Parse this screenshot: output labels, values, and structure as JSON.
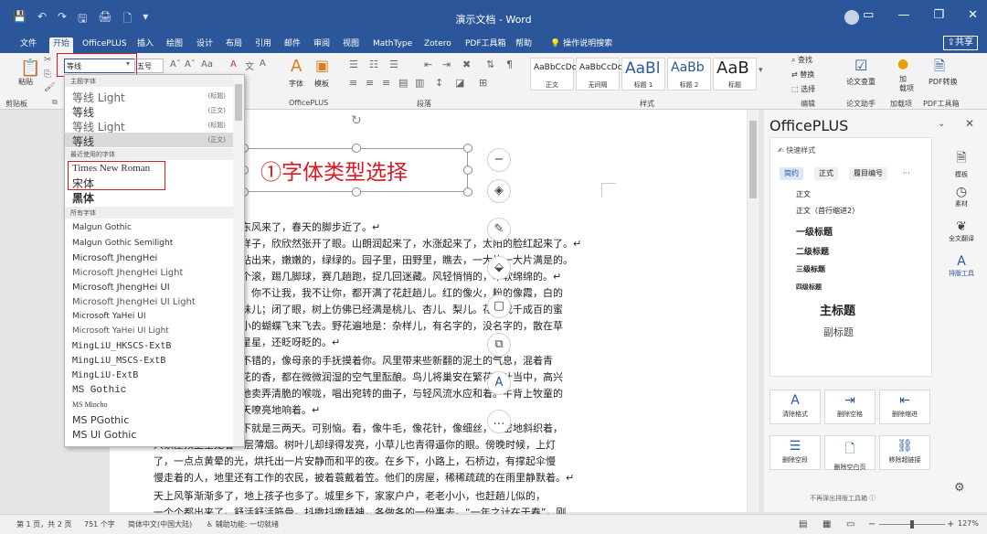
{
  "window": {
    "title": "演示文档 - Word",
    "controls": [
      "▭",
      "—",
      "❐",
      "✕"
    ]
  },
  "quick_access": [
    "💾",
    "↶",
    "↷",
    "🖫",
    "🖨",
    "🗋",
    "▾"
  ],
  "tabs": [
    "文件",
    "开始",
    "OfficePLUS",
    "插入",
    "绘图",
    "设计",
    "布局",
    "引用",
    "邮件",
    "审阅",
    "视图",
    "MathType",
    "Zotero",
    "PDF工具箱",
    "帮助"
  ],
  "tell_me": "操作说明搜索",
  "share": "共享",
  "ribbon": {
    "font_name": "等线",
    "font_size": "五号",
    "paste": "粘贴",
    "clipboard": "剪贴板",
    "font_group_btn": "字体",
    "template_btn": "模板",
    "officeplus_group": "OfficePLUS",
    "paragraph_group": "段落",
    "styles_group": "样式",
    "editing_group": "编辑",
    "find": "查找",
    "replace": "替换",
    "select": "选择",
    "thesis_check": "论文查重",
    "thesis_helper": "论文助手",
    "add_in": "加\n载项",
    "add_in_group": "加载项",
    "pdf_convert": "PDF转换",
    "pdf_group": "PDF工具箱",
    "styles": [
      {
        "preview": "AaBbCcDc",
        "name": "正文"
      },
      {
        "preview": "AaBbCcDc",
        "name": "无间隔"
      },
      {
        "preview": "AaBl",
        "name": "标题 1"
      },
      {
        "preview": "AaBb",
        "name": "标题 2"
      },
      {
        "preview": "AaB",
        "name": "标题"
      }
    ]
  },
  "font_dropdown": {
    "theme_header": "主题字体",
    "theme_fonts": [
      {
        "name": "等线 Light",
        "tag": "(标题)"
      },
      {
        "name": "等线",
        "tag": "(正文)"
      },
      {
        "name": "等线 Light",
        "tag": "(标题)"
      },
      {
        "name": "等线",
        "tag": "(正文)"
      }
    ],
    "recent_header": "最近使用的字体",
    "recent_fonts": [
      "Times New Roman",
      "宋体",
      "黑体"
    ],
    "all_header": "所有字体",
    "all_fonts": [
      "Malgun Gothic",
      "Malgun Gothic Semilight",
      "Microsoft JhengHei",
      "Microsoft JhengHei Light",
      "Microsoft JhengHei UI",
      "Microsoft JhengHei UI Light",
      "Microsoft YaHei UI",
      "Microsoft YaHei UI Light",
      "MingLiU_HKSCS-ExtB",
      "MingLiU_MSCS-ExtB",
      "MingLiU-ExtB",
      "MS Gothic",
      "MS Mincho",
      "MS PGothic",
      "MS UI Gothic"
    ]
  },
  "annotation": "①字体类型选择",
  "document_lines": [
    "东风来了，春天的脚步近了。↵",
    "样子，欣欣然张开了眼。山朗润起来了，水涨起来了，太阳的脸红起来了。↵",
    "钻出来，嫩嫩的，绿绿的。园子里，田野里，瞧去，一大片一大片满是的。",
    "个滚，踢几脚球，赛几趟跑，捉几回迷藏。风轻悄悄的，草软绵绵的。↵",
    "，你不让我，我不让你，都开满了花赶趟儿。红的像火，粉的像霞，白的",
    "味儿；闭了眼，树上仿佛已经满是桃儿、杏儿、梨儿。花下成千成百的蜜",
    "小的蝴蝶飞来飞去。野花遍地是：杂样儿，有名字的，没名字的，散在草",
    "星星，还眨呀眨的。↵",
    "   不错的，像母亲的手抚摸着你。风里带来些新翻的泥土的气息，混着青",
    "花的香，都在微微润湿的空气里酝酿。鸟儿将巢安在繁花嫩叶当中，高兴",
    "地卖弄清脆的喉咙，唱出宛转的曲子，与轻风流水应和着。牛背上牧童的",
    "天嘹亮地响着。↵",
    "下就是三两天。可别恼。看，像牛毛，像花针，像细丝，密密地斜织着，",
    "人家屋顶上全笼着一层薄烟。树叶儿却绿得发亮，小草儿也青得逼你的眼。傍晚时候，上灯",
    "了，一点点黄晕的光，烘托出一片安静而和平的夜。在乡下，小路上，石桥边，有撑起伞慢",
    "慢走着的人，地里还有工作的农民，披着蓑戴着笠。他们的房屋，稀稀疏疏的在雨里静默着。↵",
    "天上风筝渐渐多了，地上孩子也多了。城里乡下，家家户户，老老小小，也赶趟儿似的，",
    "一个个都出来了。舒活舒活筋骨，抖擞抖擞精神，各做各的一份事去。“一年之计在于春”，刚"
  ],
  "pane": {
    "title": "OfficePLUS",
    "quick_styles": "快速样式",
    "pills": [
      "简约",
      "正式",
      "履目编号",
      "···"
    ],
    "style_items": [
      "正文",
      "正文（首行缩进2）",
      "一级标题",
      "二级标题",
      "三级标题",
      "四级标题",
      "主标题",
      "副标题"
    ],
    "tools": [
      {
        "icon": "A",
        "label": "清除格式"
      },
      {
        "icon": "⇥",
        "label": "删除空格"
      },
      {
        "icon": "⇤",
        "label": "删除缩进"
      },
      {
        "icon": "☰",
        "label": "删除空段"
      },
      {
        "icon": "🗋",
        "label": "删除空白页"
      },
      {
        "icon": "⛓",
        "label": "移除超链接"
      }
    ],
    "dont_show": "不再弹出排版工具箱 ⓘ",
    "side_tools": [
      {
        "icon": "🗎",
        "label": "模板"
      },
      {
        "icon": "◷",
        "label": "素材"
      },
      {
        "icon": "❦",
        "label": "全文翻译"
      },
      {
        "icon": "A",
        "label": "排版工具"
      }
    ]
  },
  "status": {
    "page": "第 1 页，共 2 页",
    "words": "751 个字",
    "lang": "简体中文(中国大陆)",
    "access": "辅助功能: 一切就绪",
    "zoom": "127%"
  }
}
